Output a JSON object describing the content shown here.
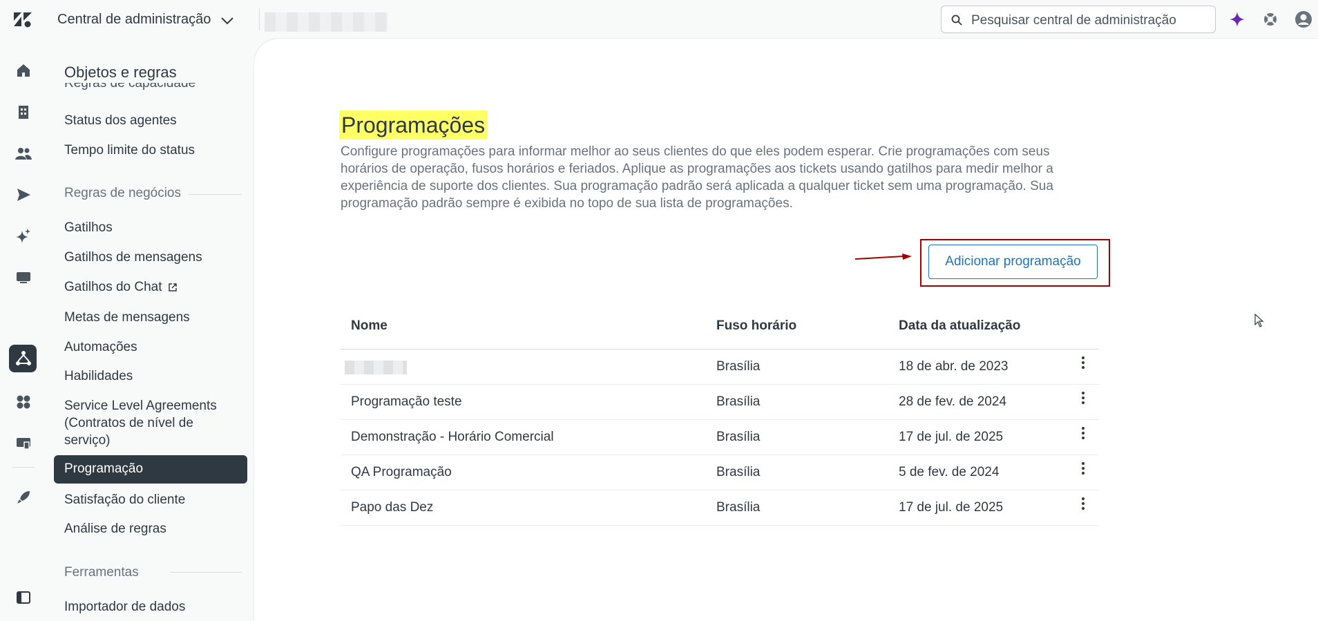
{
  "topbar": {
    "app_title": "Central de administração",
    "search_placeholder": "Pesquisar central de administração"
  },
  "nav": {
    "title": "Objetos e regras",
    "partial_item": "Regras de capacidade",
    "items_top": [
      "Status dos agentes",
      "Tempo limite do status"
    ],
    "section_business": "Regras de negócios",
    "business_items": [
      "Gatilhos",
      "Gatilhos de mensagens",
      "Gatilhos do Chat",
      "Metas de mensagens",
      "Automações",
      "Habilidades",
      "Service Level Agreements (Contratos de nível de serviço)",
      "Programação",
      "Satisfação do cliente",
      "Análise de regras"
    ],
    "section_tools": "Ferramentas",
    "tools_items": [
      "Importador de dados"
    ]
  },
  "main": {
    "title": "Programações",
    "description": "Configure programações para informar melhor ao seus clientes do que eles podem esperar. Crie programações com seus horários de operação, fusos horários e feriados. Aplique as programações aos tickets usando gatilhos para medir melhor a experiência de suporte dos clientes. Sua programação padrão será aplicada a qualquer ticket sem uma programação. Sua programação padrão sempre é exibida no topo de sua lista de programações.",
    "add_button": "Adicionar programação",
    "table": {
      "headers": [
        "Nome",
        "Fuso horário",
        "Data da atualização"
      ],
      "rows": [
        {
          "name": "",
          "tz": "Brasília",
          "updated": "18 de abr. de 2023"
        },
        {
          "name": "Programação teste",
          "tz": "Brasília",
          "updated": "28 de fev. de 2024"
        },
        {
          "name": "Demonstração - Horário Comercial",
          "tz": "Brasília",
          "updated": "17 de jul. de 2025"
        },
        {
          "name": "QA Programação",
          "tz": "Brasília",
          "updated": "5 de fev. de 2024"
        },
        {
          "name": "Papo das Dez",
          "tz": "Brasília",
          "updated": "17 de jul. de 2025"
        }
      ]
    }
  },
  "colors": {
    "accent": "#1f73b7",
    "highlight": "#ffff66",
    "annotation": "#a00000",
    "active_nav": "#2f3941",
    "ai_icon": "#6a27b8"
  }
}
